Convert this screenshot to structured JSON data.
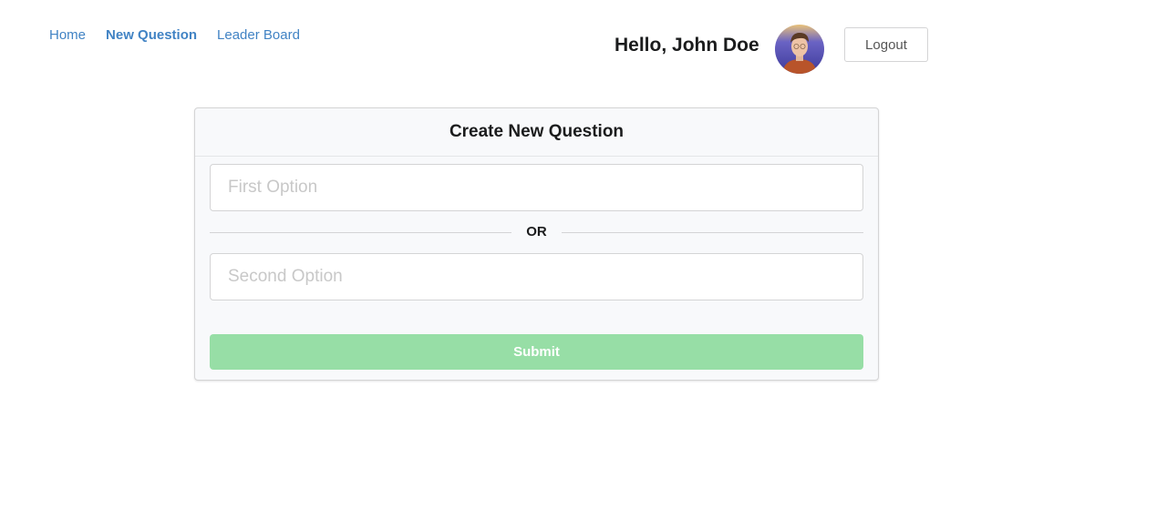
{
  "nav": {
    "items": [
      {
        "label": "Home",
        "active": false
      },
      {
        "label": "New Question",
        "active": true
      },
      {
        "label": "Leader Board",
        "active": false
      }
    ]
  },
  "user": {
    "greeting": "Hello, John Doe",
    "logout_label": "Logout"
  },
  "form": {
    "title": "Create New Question",
    "first_option": {
      "value": "",
      "placeholder": "First Option"
    },
    "divider_label": "OR",
    "second_option": {
      "value": "",
      "placeholder": "Second Option"
    },
    "submit_label": "Submit"
  },
  "colors": {
    "link": "#4183c4",
    "submit_disabled": "#97dea6",
    "card_bg": "#f8f9fb",
    "border": "#d4d4d5"
  }
}
